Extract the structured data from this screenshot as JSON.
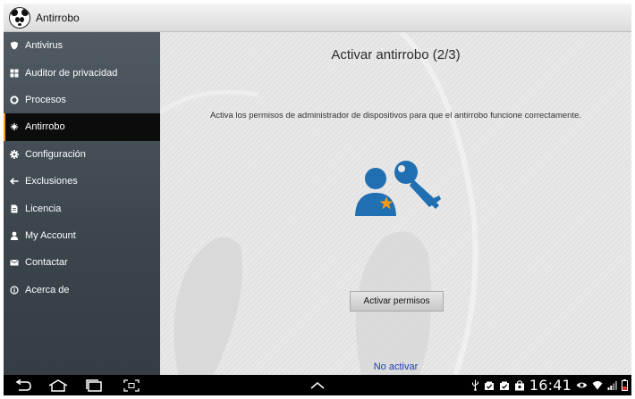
{
  "app": {
    "title": "Antirrobo"
  },
  "sidebar": {
    "active_index": 3,
    "items": [
      {
        "label": "Antivirus",
        "icon": "shield-icon"
      },
      {
        "label": "Auditor de privacidad",
        "icon": "grid-icon"
      },
      {
        "label": "Procesos",
        "icon": "circle-icon"
      },
      {
        "label": "Antirrobo",
        "icon": "antitheft-icon"
      },
      {
        "label": "Configuración",
        "icon": "gear-icon"
      },
      {
        "label": "Exclusiones",
        "icon": "arrow-left-icon"
      },
      {
        "label": "Licencia",
        "icon": "document-icon"
      },
      {
        "label": "My Account",
        "icon": "person-icon"
      },
      {
        "label": "Contactar",
        "icon": "mail-icon"
      },
      {
        "label": "Acerca de",
        "icon": "info-icon"
      }
    ]
  },
  "main": {
    "heading": "Activar antirrobo (2/3)",
    "description": "Activa los permisos de administrador de dispositivos para que el antirrobo funcione correctamente.",
    "primary_button": "Activar permisos",
    "link": "No activar"
  },
  "colors": {
    "accent_blue": "#1f6fb2",
    "badge_orange": "#f29a1a",
    "link_blue": "#1a3fb5",
    "active_indicator": "#ff9a1f"
  },
  "system_bar": {
    "clock": "16:41",
    "nav_icons": [
      "back-icon",
      "home-icon",
      "recent-apps-icon",
      "screenshot-icon",
      "chevron-up-icon"
    ],
    "status_icons": [
      "usb-icon",
      "notification-check-icon",
      "notification-check-icon",
      "store-icon",
      "eye-icon",
      "wifi-icon",
      "signal-icon",
      "battery-icon"
    ]
  }
}
